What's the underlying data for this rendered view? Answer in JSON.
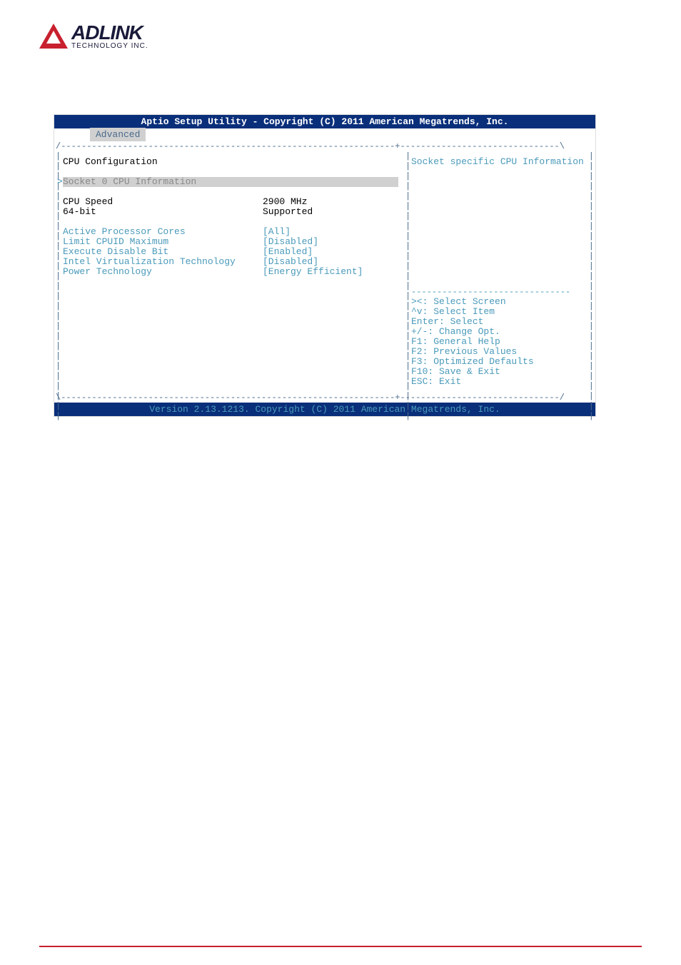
{
  "logo": {
    "main": "ADLINK",
    "sub": "TECHNOLOGY INC."
  },
  "bios": {
    "header": "Aptio Setup Utility - Copyright (C) 2011 American Megatrends, Inc.",
    "tab": "Advanced",
    "section_title": "CPU Configuration",
    "submenu": "Socket 0 CPU Information",
    "info_rows": [
      {
        "label": "CPU Speed",
        "value": "2900 MHz"
      },
      {
        "label": "64-bit",
        "value": "Supported"
      }
    ],
    "config_rows": [
      {
        "label": "Active Processor Cores",
        "value": "[All]"
      },
      {
        "label": "Limit CPUID Maximum",
        "value": "[Disabled]"
      },
      {
        "label": "Execute Disable Bit",
        "value": "[Enabled]"
      },
      {
        "label": "Intel Virtualization Technology",
        "value": "[Disabled]"
      },
      {
        "label": "Power Technology",
        "value": "[Energy Efficient]"
      }
    ],
    "side_info": "Socket specific CPU Information",
    "help": [
      "><: Select Screen",
      "^v: Select Item",
      "Enter: Select",
      "+/-: Change Opt.",
      "F1: General Help",
      "F2: Previous Values",
      "F3: Optimized Defaults",
      "F10: Save & Exit",
      "ESC: Exit"
    ],
    "footer": "Version 2.13.1213. Copyright (C) 2011 American Megatrends, Inc."
  }
}
